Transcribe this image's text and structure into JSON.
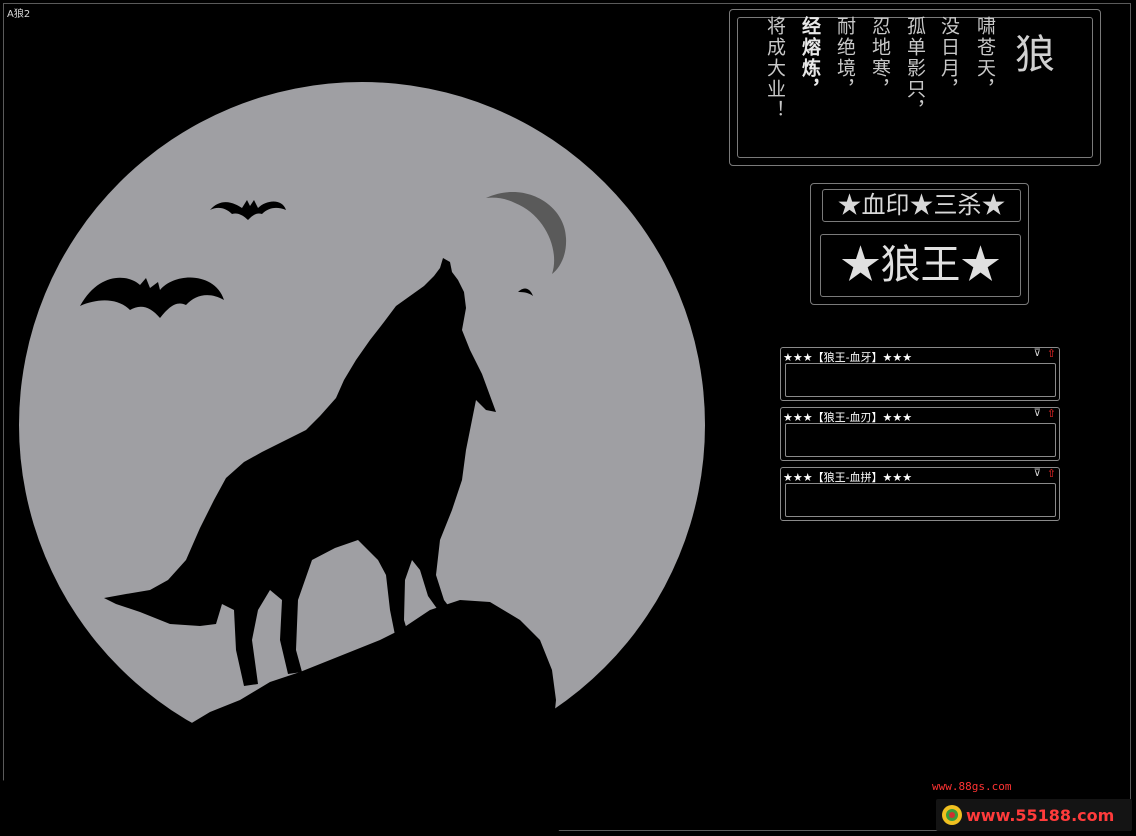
{
  "window": {
    "title": "A狼2"
  },
  "poem": {
    "title": "狼",
    "columns": [
      "啸苍天，",
      "没日月，",
      "孤单影只，",
      "忍地寒，",
      "耐绝境，",
      "经熔炼，",
      "将成大业！"
    ]
  },
  "badges": {
    "small": "★血印★三杀★",
    "large": "★狼王★"
  },
  "panels": [
    {
      "title": "★★★【狼王-血牙】★★★"
    },
    {
      "title": "★★★【狼王-血刃】★★★"
    },
    {
      "title": "★★★【狼王-血拼】★★★"
    }
  ],
  "footer": {
    "link": "www.88gs.com",
    "logo_text": "www.55188.com"
  },
  "colors": {
    "background": "#000000",
    "moon": "#9f9fa3",
    "border": "#7a7a7a",
    "accent_red": "#ff2a2a"
  }
}
